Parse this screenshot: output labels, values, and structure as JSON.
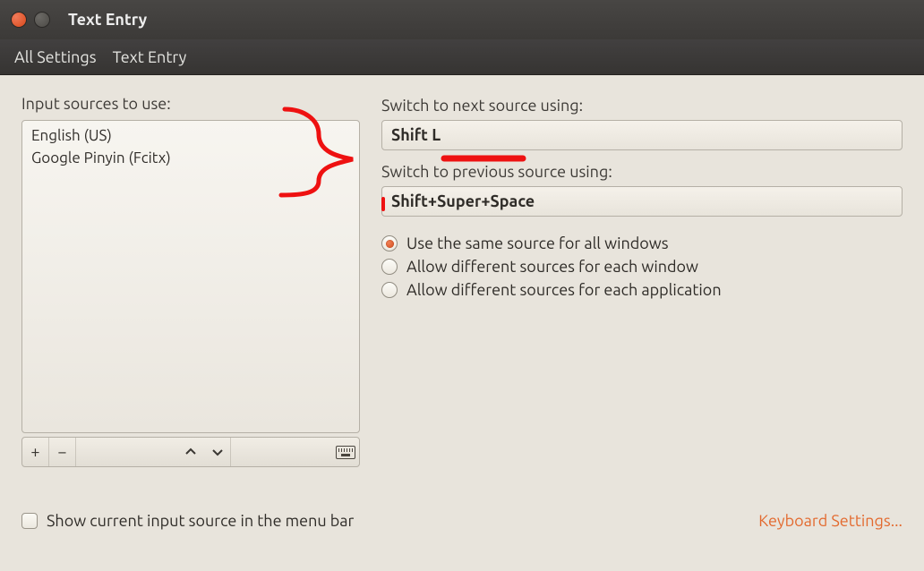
{
  "window": {
    "title": "Text Entry"
  },
  "breadcrumb": {
    "all_settings": "All Settings",
    "current": "Text Entry"
  },
  "left": {
    "label": "Input sources to use:",
    "items": [
      "English (US)",
      "Google Pinyin (Fcitx)"
    ],
    "toolbar": {
      "add": "+",
      "remove": "−",
      "up": "˄",
      "down": "˅"
    }
  },
  "right": {
    "next_label": "Switch to next source using:",
    "next_value": "Shift L",
    "prev_label": "Switch to previous source using:",
    "prev_value": "Shift+Super+Space",
    "radios": {
      "same": "Use the same source for all windows",
      "each_window": "Allow different sources for each window",
      "each_app": "Allow different sources for each application",
      "selected": "same"
    }
  },
  "bottom": {
    "show_in_menu_label": "Show current input source in the menu bar",
    "keyboard_settings": "Keyboard Settings..."
  }
}
